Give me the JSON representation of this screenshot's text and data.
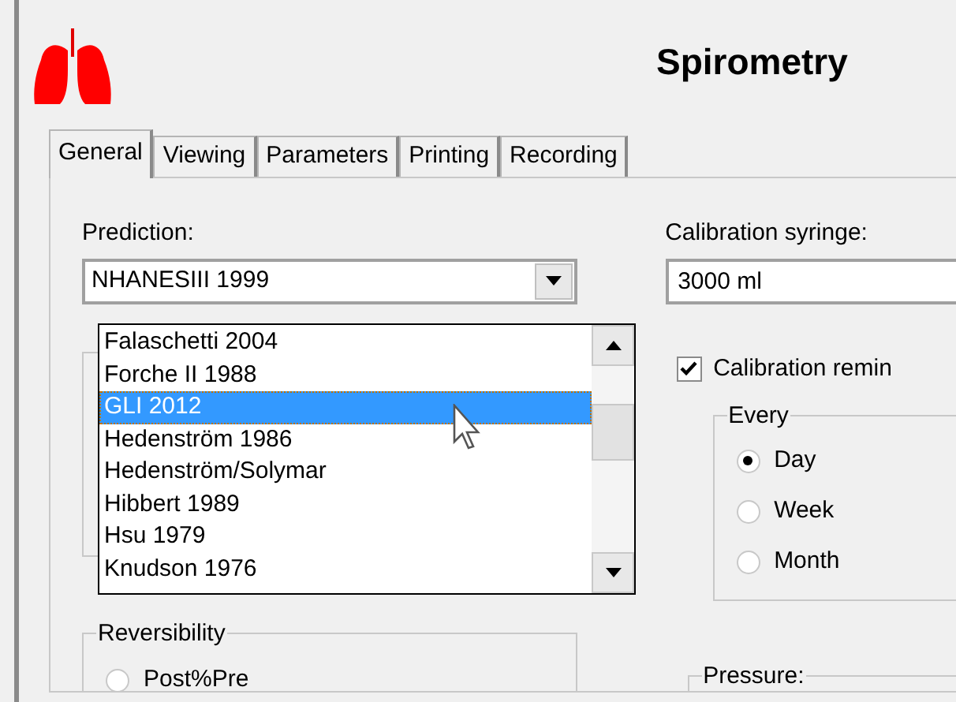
{
  "header": {
    "title": "Spirometry"
  },
  "tabs": [
    {
      "label": "General",
      "selected": true
    },
    {
      "label": "Viewing",
      "selected": false
    },
    {
      "label": "Parameters",
      "selected": false
    },
    {
      "label": "Printing",
      "selected": false
    },
    {
      "label": "Recording",
      "selected": false
    }
  ],
  "prediction": {
    "label": "Prediction:",
    "value": "NHANESIII 1999",
    "options": [
      {
        "label": "Falaschetti 2004",
        "selected": false
      },
      {
        "label": "Forche II 1988",
        "selected": false
      },
      {
        "label": "GLI 2012",
        "selected": true
      },
      {
        "label": "Hedenström 1986",
        "selected": false
      },
      {
        "label": "Hedenström/Solymar",
        "selected": false
      },
      {
        "label": "Hibbert 1989",
        "selected": false
      },
      {
        "label": "Hsu 1979",
        "selected": false
      },
      {
        "label": "Knudson 1976",
        "selected": false
      }
    ]
  },
  "calibration_syringe": {
    "label": "Calibration syringe:",
    "value": "3000 ml"
  },
  "calibration_reminder": {
    "label": "Calibration remin",
    "checked": true
  },
  "every": {
    "title": "Every",
    "options": [
      {
        "label": "Day",
        "selected": true
      },
      {
        "label": "Week",
        "selected": false
      },
      {
        "label": "Month",
        "selected": false
      }
    ]
  },
  "reversibility": {
    "title": "Reversibility",
    "options": [
      {
        "label": "Post%Pre",
        "selected": false
      }
    ]
  },
  "pressure": {
    "title": "Pressure:"
  }
}
